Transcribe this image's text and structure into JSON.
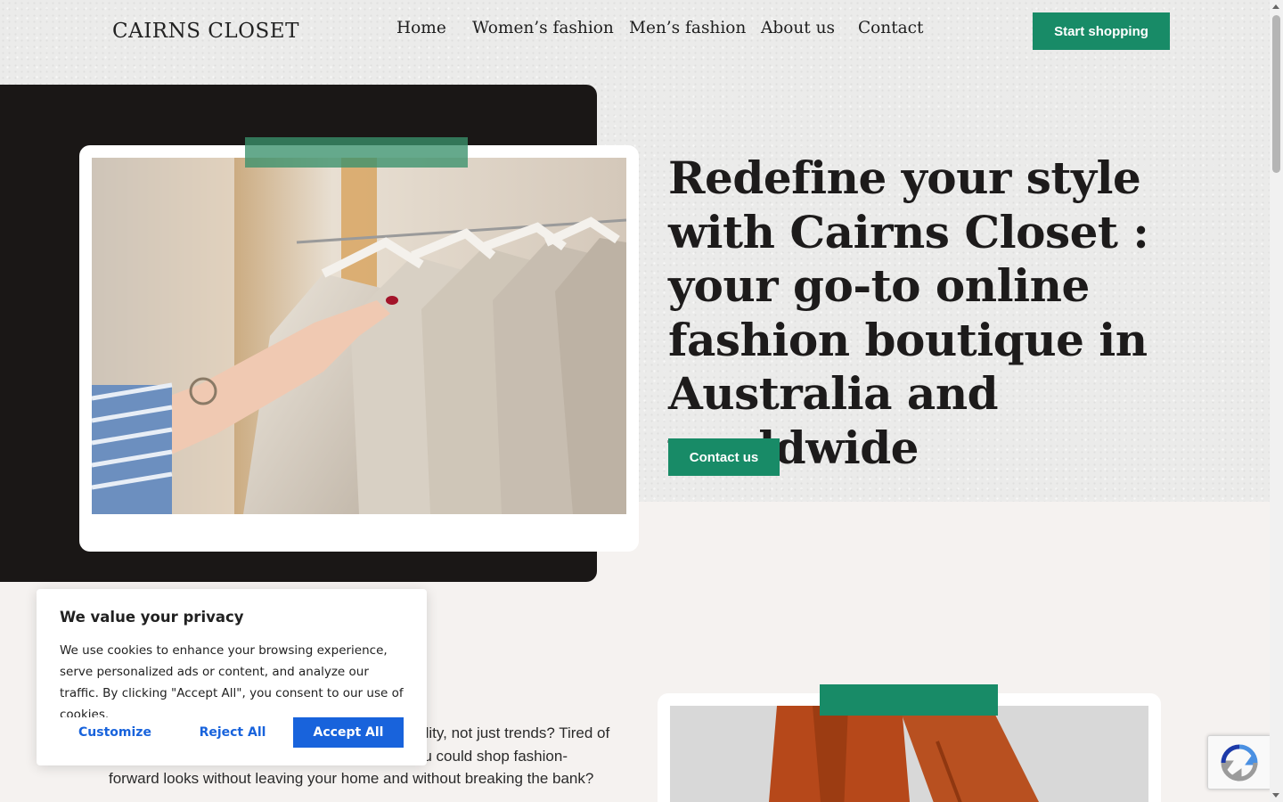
{
  "header": {
    "logo": "CAIRNS CLOSET",
    "nav": [
      "Home",
      "Women’s fashion",
      "Men’s fashion",
      "About us",
      "Contact"
    ],
    "cta_label": "Start shopping"
  },
  "hero": {
    "title": "Redefine your style with Cairns Closet : your go-to online fashion boutique in Australia and worldwide",
    "button_label": "Contact us",
    "photo_alt": "hand-browsing-clothes-rack-photo"
  },
  "intro": {
    "paragraph": "Want to dress for who you are, focusing on quality, not just trends? Tired of the same styles everywhere you look? Wish you could shop fashion-forward looks without leaving your home and without breaking the bank?"
  },
  "cookie_banner": {
    "title": "We value your privacy",
    "text": "We use cookies to enhance your browsing experience, serve personalized ads or content, and analyze our traffic. By clicking \"Accept All\", you consent to our use of cookies.",
    "customize_label": "Customize",
    "reject_label": "Reject All",
    "accept_label": "Accept All"
  },
  "colors": {
    "accent_green": "#188b67",
    "cookie_blue": "#1863dc",
    "dark_block": "#1a1716"
  },
  "icons": {
    "recaptcha": "recaptcha-icon"
  }
}
